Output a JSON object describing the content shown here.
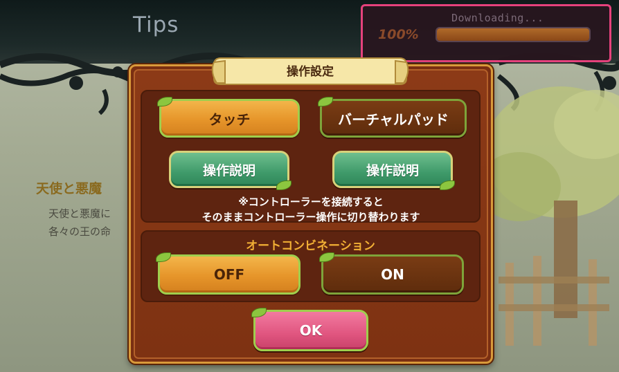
{
  "background": {
    "title": "Tips",
    "tip_title": "天使と悪魔",
    "tip_lines": [
      "天使と悪魔に",
      "各々の王の命"
    ]
  },
  "download": {
    "label": "Downloading...",
    "percent_text": "100%",
    "progress": 100
  },
  "dialog": {
    "title": "操作設定",
    "control_buttons": {
      "touch": "タッチ",
      "virtual_pad": "バーチャルパッド"
    },
    "help_buttons": {
      "touch_help": "操作説明",
      "pad_help": "操作説明"
    },
    "note_lines": [
      "※コントローラーを接続すると",
      "そのままコントローラー操作に切り替わります"
    ],
    "auto_combo": {
      "title": "オートコンビネーション",
      "off": "OFF",
      "on": "ON"
    },
    "ok": "OK"
  },
  "colors": {
    "download_border": "#e5427c",
    "selected_button": "#e6952a",
    "unselected_button": "#5e2c0c",
    "help_button": "#3f9a6a",
    "ok_button": "#e0557f",
    "combo_title": "#f2b035"
  },
  "icons": [
    "vine-ornament-icon",
    "leaf-icon",
    "scroll-banner-icon",
    "tree-icon"
  ]
}
